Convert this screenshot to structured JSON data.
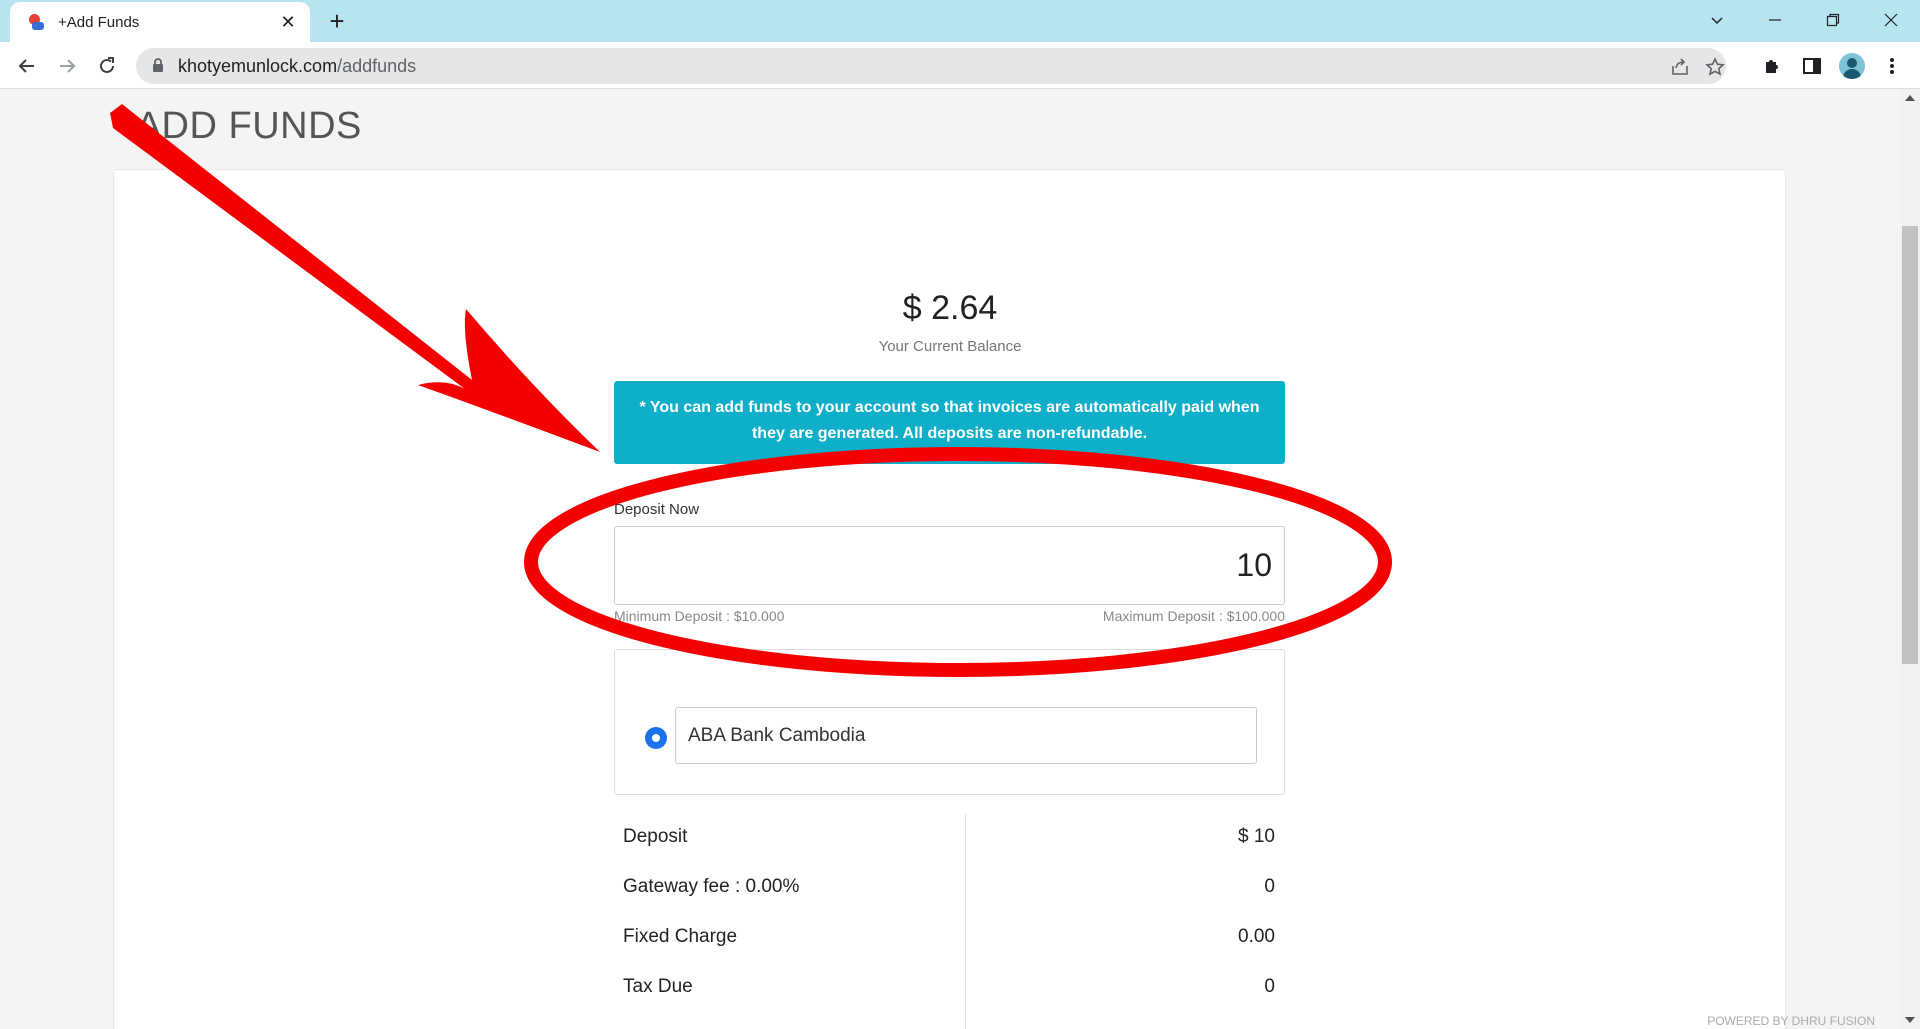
{
  "browser": {
    "tab_title": "+Add Funds",
    "url_host": "khotyemunlock.com",
    "url_path": "/addfunds"
  },
  "page": {
    "title": "+ADD FUNDS",
    "balance": "$ 2.64",
    "balance_label": "Your Current Balance",
    "info_message": "* You can add funds to your account so that invoices are automatically paid when they are generated. All deposits are non-refundable.",
    "deposit_label": "Deposit Now",
    "deposit_value": "10",
    "min_deposit": "Minimum Deposit : $10.000",
    "max_deposit": "Maximum Deposit : $100.000",
    "gateway": "ABA Bank Cambodia",
    "summary": [
      {
        "label": "Deposit",
        "value": "$ 10"
      },
      {
        "label": "Gateway fee : 0.00%",
        "value": "0"
      },
      {
        "label": "Fixed Charge",
        "value": "0.00"
      },
      {
        "label": "Tax Due",
        "value": "0"
      }
    ],
    "powered_by": "POWERED BY DHRU FUSION"
  },
  "colors": {
    "info_bg": "#10afc9",
    "annotation": "#f50000",
    "radio": "#1a73e8"
  }
}
